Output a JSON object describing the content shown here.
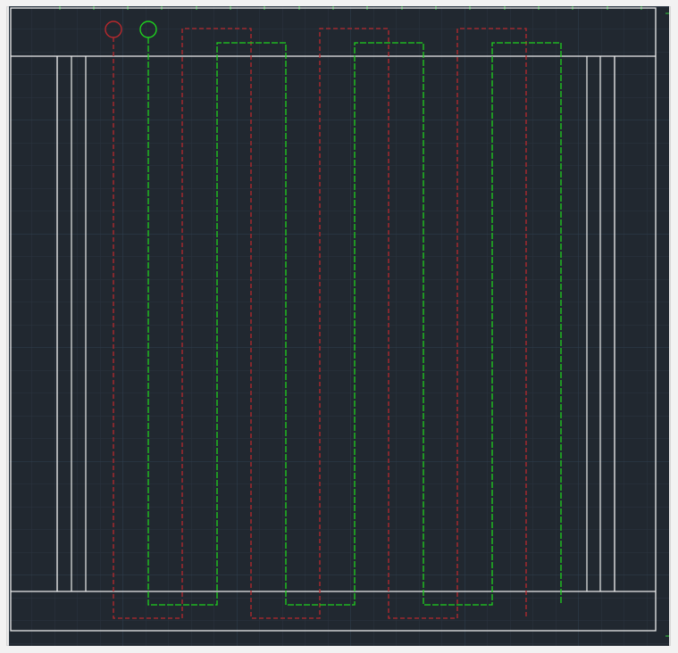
{
  "canvas": {
    "background": "#212830",
    "grid_minor_color": "#2a3440",
    "grid_major_color": "#304050",
    "outline_color": "#e8e8e8",
    "red_color": "#b8282d",
    "green_color": "#1fd11f"
  },
  "drawing": {
    "outer_border": "outer-boundary",
    "inner_frame": "inner-frame",
    "left_band": "left-vertical-band",
    "right_band": "right-vertical-band",
    "red_loop": "red-serpentine-loop",
    "green_loop": "green-serpentine-loop",
    "red_endpoint": "red-circle-endpoint",
    "green_endpoint": "green-circle-endpoint"
  }
}
